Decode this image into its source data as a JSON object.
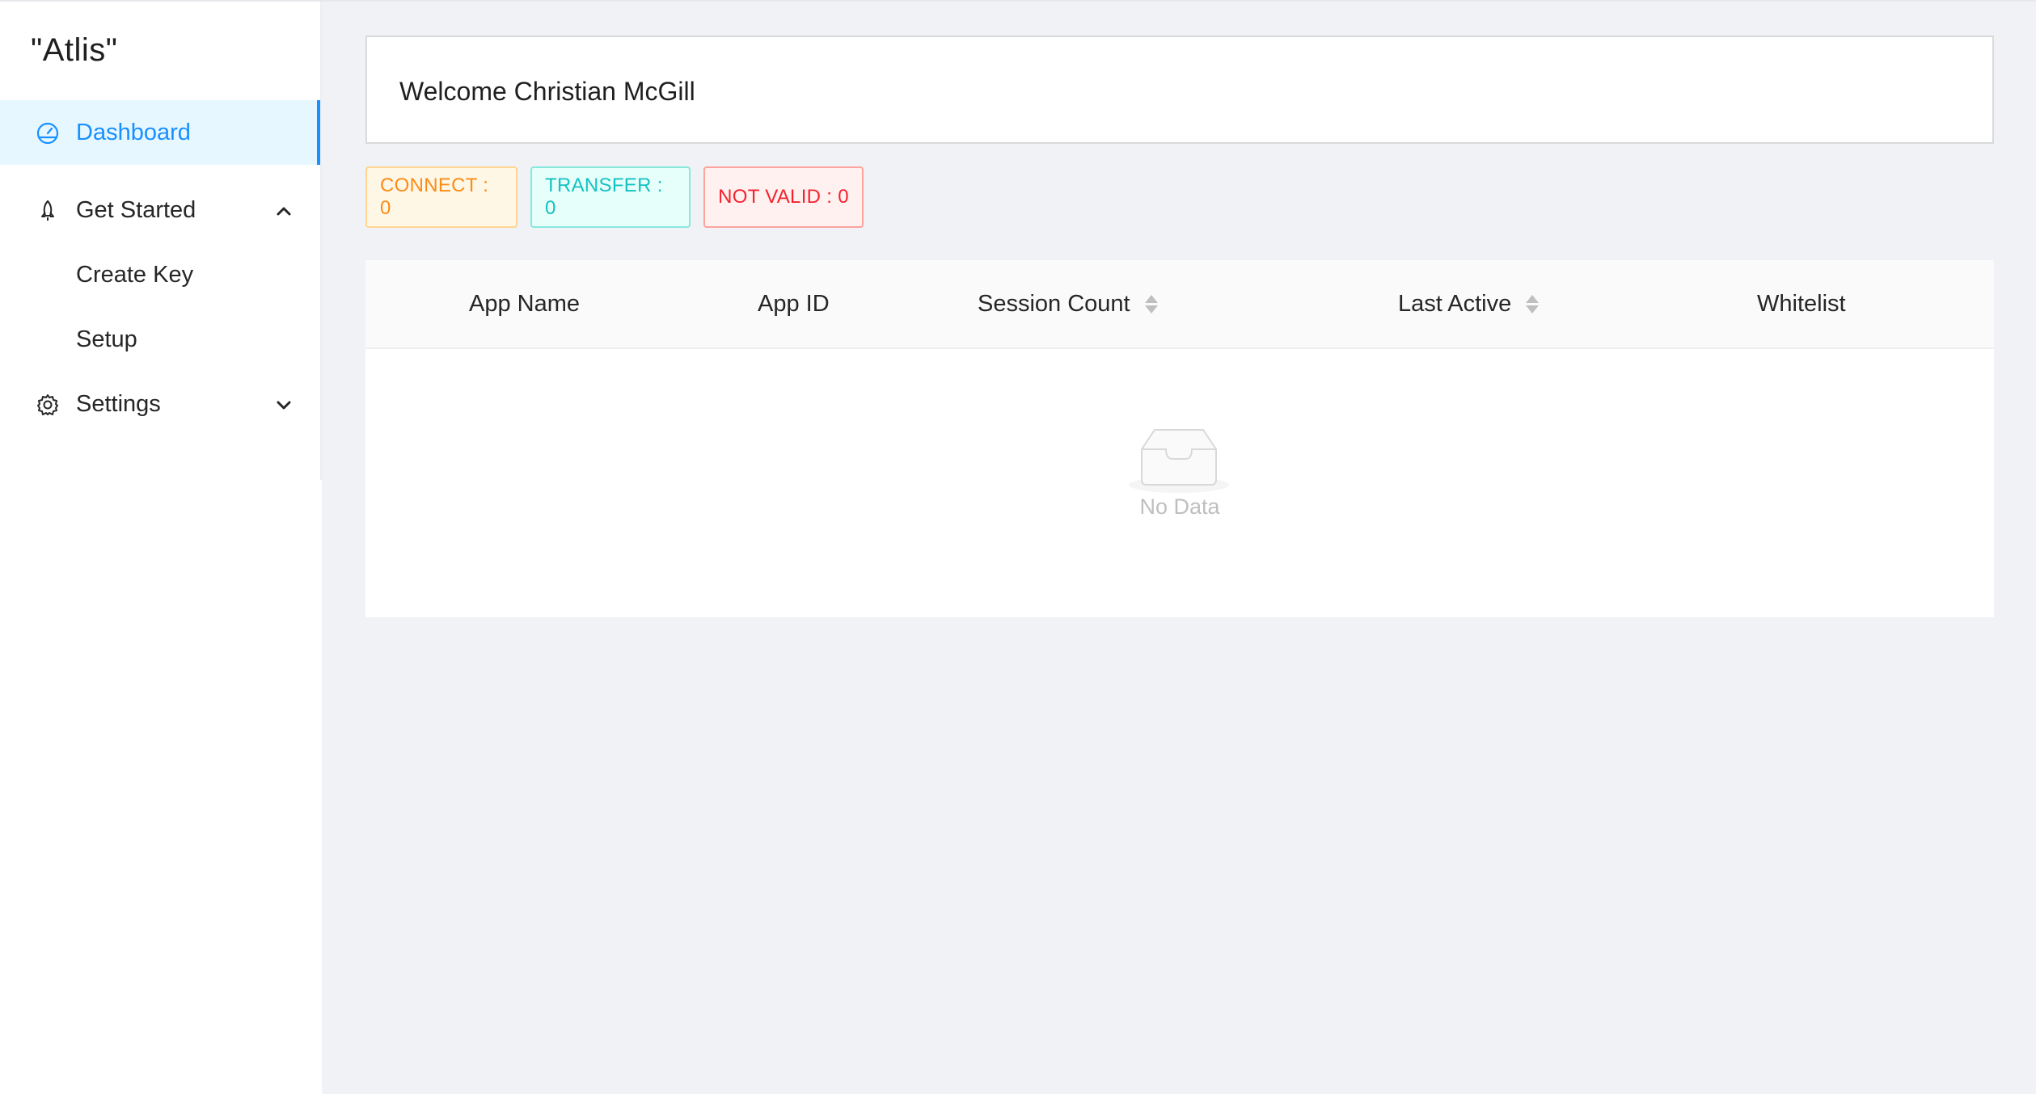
{
  "app": {
    "logo": "\"Atlis\""
  },
  "sidebar": {
    "items": [
      {
        "label": "Dashboard",
        "icon": "dashboard-icon",
        "active": true
      },
      {
        "label": "Get Started",
        "icon": "rocket-icon",
        "expanded": true,
        "children": [
          {
            "label": "Create Key"
          },
          {
            "label": "Setup"
          }
        ]
      },
      {
        "label": "Settings",
        "icon": "gear-icon",
        "expanded": false
      }
    ]
  },
  "welcome": {
    "text": "Welcome Christian McGill"
  },
  "tags": {
    "connect": "CONNECT : 0",
    "transfer": "TRANSFER : 0",
    "invalid": "NOT VALID : 0"
  },
  "table": {
    "columns": [
      "App Name",
      "App ID",
      "Session Count",
      "Last Active",
      "Whitelist"
    ],
    "sortable": [
      "Session Count",
      "Last Active"
    ],
    "rows": [],
    "empty_text": "No Data"
  },
  "colors": {
    "primary": "#1890ff",
    "connect": "#fa8c16",
    "transfer": "#13c2c2",
    "invalid": "#f5222d"
  }
}
